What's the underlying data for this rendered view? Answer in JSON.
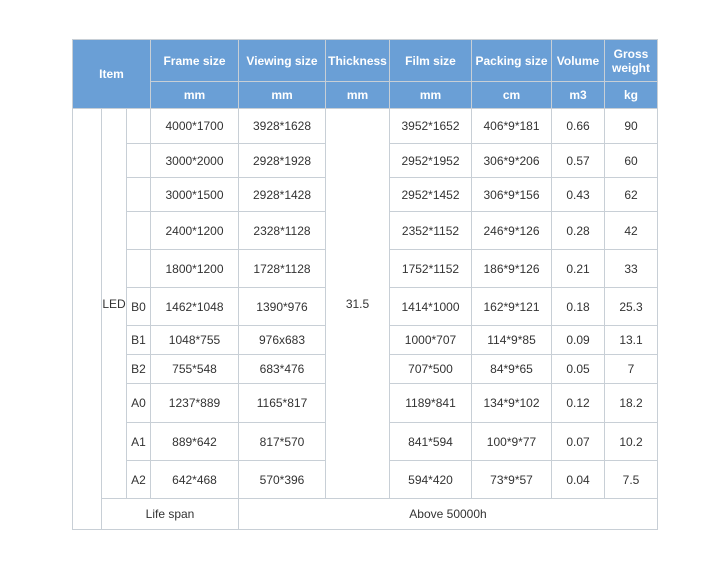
{
  "header": {
    "item": "Item",
    "columns": [
      "Frame size",
      "Viewing size",
      "Thickness",
      "Film size",
      "Packing size",
      "Volume",
      "Gross weight"
    ],
    "units": [
      "mm",
      "mm",
      "mm",
      "mm",
      "cm",
      "m3",
      "kg"
    ]
  },
  "category": "LED",
  "thickness": "31.5",
  "rows": [
    {
      "sub": "",
      "frame": "4000*1700",
      "viewing": "3928*1628",
      "film": "3952*1652",
      "packing": "406*9*181",
      "volume": "0.66",
      "weight": "90"
    },
    {
      "sub": "",
      "frame": "3000*2000",
      "viewing": "2928*1928",
      "film": "2952*1952",
      "packing": "306*9*206",
      "volume": "0.57",
      "weight": "60"
    },
    {
      "sub": "",
      "frame": "3000*1500",
      "viewing": "2928*1428",
      "film": "2952*1452",
      "packing": "306*9*156",
      "volume": "0.43",
      "weight": "62"
    },
    {
      "sub": "",
      "frame": "2400*1200",
      "viewing": "2328*1128",
      "film": "2352*1152",
      "packing": "246*9*126",
      "volume": "0.28",
      "weight": "42"
    },
    {
      "sub": "",
      "frame": "1800*1200",
      "viewing": "1728*1128",
      "film": "1752*1152",
      "packing": "186*9*126",
      "volume": "0.21",
      "weight": "33"
    },
    {
      "sub": "B0",
      "frame": "1462*1048",
      "viewing": "1390*976",
      "film": "1414*1000",
      "packing": "162*9*121",
      "volume": "0.18",
      "weight": "25.3"
    },
    {
      "sub": "B1",
      "frame": "1048*755",
      "viewing": "976x683",
      "film": "1000*707",
      "packing": "114*9*85",
      "volume": "0.09",
      "weight": "13.1"
    },
    {
      "sub": "B2",
      "frame": "755*548",
      "viewing": "683*476",
      "film": "707*500",
      "packing": "84*9*65",
      "volume": "0.05",
      "weight": "7"
    },
    {
      "sub": "A0",
      "frame": "1237*889",
      "viewing": "1165*817",
      "film": "1189*841",
      "packing": "134*9*102",
      "volume": "0.12",
      "weight": "18.2"
    },
    {
      "sub": "A1",
      "frame": "889*642",
      "viewing": "817*570",
      "film": "841*594",
      "packing": "100*9*77",
      "volume": "0.07",
      "weight": "10.2"
    },
    {
      "sub": "A2",
      "frame": "642*468",
      "viewing": "570*396",
      "film": "594*420",
      "packing": "73*9*57",
      "volume": "0.04",
      "weight": "7.5"
    }
  ],
  "footer": {
    "label": "Life span",
    "value": "Above 50000h"
  }
}
